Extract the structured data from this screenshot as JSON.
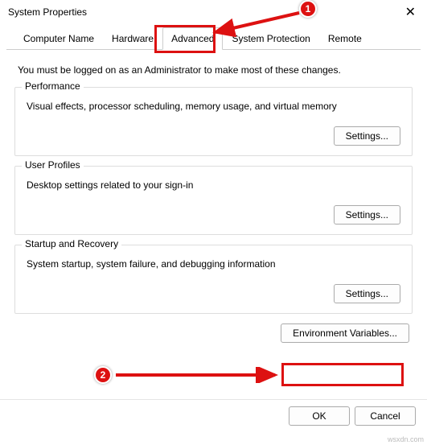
{
  "window": {
    "title": "System Properties"
  },
  "tabs": [
    {
      "label": "Computer Name",
      "active": false
    },
    {
      "label": "Hardware",
      "active": false
    },
    {
      "label": "Advanced",
      "active": true
    },
    {
      "label": "System Protection",
      "active": false
    },
    {
      "label": "Remote",
      "active": false
    }
  ],
  "info_text": "You must be logged on as an Administrator to make most of these changes.",
  "groups": {
    "performance": {
      "legend": "Performance",
      "desc": "Visual effects, processor scheduling, memory usage, and virtual memory",
      "button": "Settings..."
    },
    "user_profiles": {
      "legend": "User Profiles",
      "desc": "Desktop settings related to your sign-in",
      "button": "Settings..."
    },
    "startup": {
      "legend": "Startup and Recovery",
      "desc": "System startup, system failure, and debugging information",
      "button": "Settings..."
    }
  },
  "env_button": "Environment Variables...",
  "bottom": {
    "ok": "OK",
    "cancel": "Cancel"
  },
  "annotations": {
    "marker1": "1",
    "marker2": "2"
  },
  "watermark": "wsxdn.com"
}
